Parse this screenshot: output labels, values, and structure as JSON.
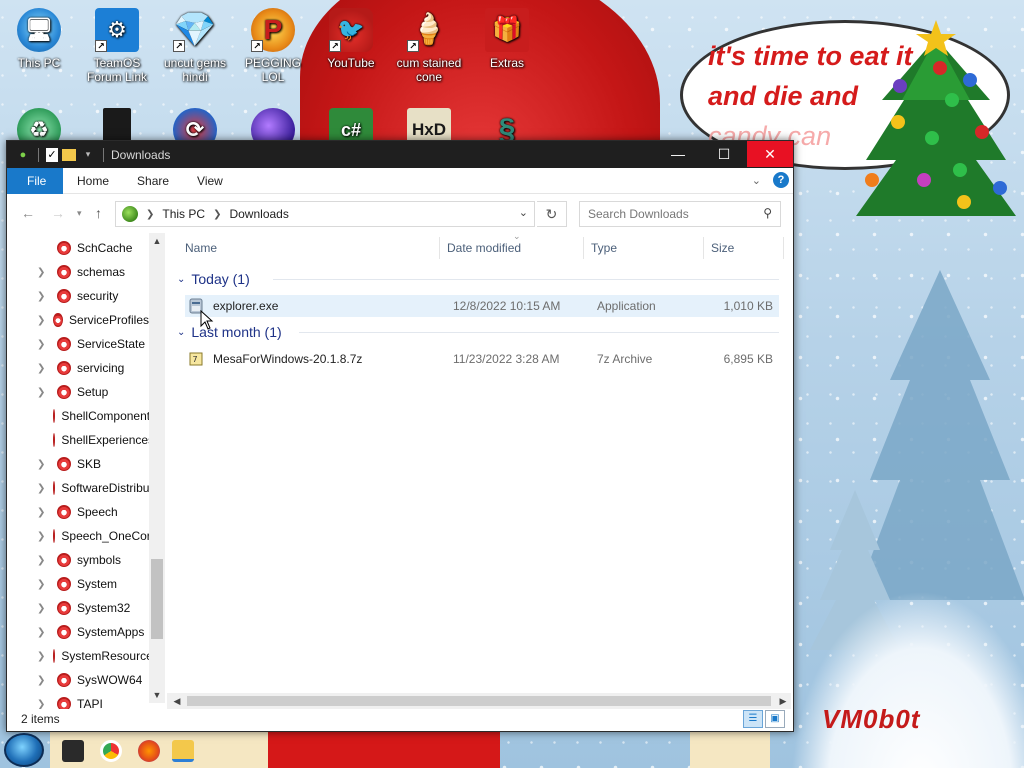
{
  "desktop": {
    "icons_row1": [
      {
        "label": "This PC",
        "icon": "this-pc-icon"
      },
      {
        "label": "TeamOS Forum Link",
        "icon": "gear-icon"
      },
      {
        "label": "uncut gems hindi",
        "icon": "diamond-icon"
      },
      {
        "label": "PEGGING LOL",
        "icon": "peggle-icon"
      },
      {
        "label": "YouTube",
        "icon": "angry-bird-icon"
      },
      {
        "label": "cum stained cone",
        "icon": "traffic-cone-icon"
      },
      {
        "label": "Extras",
        "icon": "gift-box-icon"
      }
    ],
    "icons_row2": [
      {
        "icon": "recycle-bin-icon"
      },
      {
        "icon": "book-icon"
      },
      {
        "icon": "chrome-like-icon"
      },
      {
        "icon": "christmas-ball-icon"
      },
      {
        "label": "c#",
        "icon": "csharp-icon"
      },
      {
        "label": "HxD",
        "icon": "hxd-icon"
      },
      {
        "icon": "snake-icon"
      }
    ],
    "bubble_lines": [
      "it's time to eat it",
      "and die and ",
      "candy can"
    ],
    "signature": "VM0b0t",
    "colors": {
      "hat_red": "#c41616",
      "bubble_text": "#d51b1b",
      "window_accent": "#1979ca"
    }
  },
  "window": {
    "title": "Downloads",
    "controls": {
      "minimize": "—",
      "maximize": "☐",
      "close": "✕"
    },
    "ribbon_tabs": [
      "File",
      "Home",
      "Share",
      "View"
    ],
    "address": {
      "crumbs": [
        "This PC",
        "Downloads"
      ]
    },
    "search": {
      "placeholder": "Search Downloads"
    },
    "nav_pane": [
      {
        "label": "SchCache",
        "expandable": false
      },
      {
        "label": "schemas",
        "expandable": true
      },
      {
        "label": "security",
        "expandable": true
      },
      {
        "label": "ServiceProfiles",
        "expandable": true
      },
      {
        "label": "ServiceState",
        "expandable": true
      },
      {
        "label": "servicing",
        "expandable": true
      },
      {
        "label": "Setup",
        "expandable": true
      },
      {
        "label": "ShellComponents",
        "expandable": false
      },
      {
        "label": "ShellExperiences",
        "expandable": false
      },
      {
        "label": "SKB",
        "expandable": true
      },
      {
        "label": "SoftwareDistribution",
        "expandable": true
      },
      {
        "label": "Speech",
        "expandable": true
      },
      {
        "label": "Speech_OneCore",
        "expandable": true
      },
      {
        "label": "symbols",
        "expandable": true
      },
      {
        "label": "System",
        "expandable": true
      },
      {
        "label": "System32",
        "expandable": true
      },
      {
        "label": "SystemApps",
        "expandable": true
      },
      {
        "label": "SystemResources",
        "expandable": true
      },
      {
        "label": "SysWOW64",
        "expandable": true
      },
      {
        "label": "TAPI",
        "expandable": true
      }
    ],
    "columns": {
      "name": "Name",
      "date": "Date modified",
      "type": "Type",
      "size": "Size"
    },
    "groups": [
      {
        "label": "Today (1)",
        "files": [
          {
            "name": "explorer.exe",
            "date": "12/8/2022 10:15 AM",
            "type": "Application",
            "size": "1,010 KB",
            "icon": "exe-icon",
            "selected": true
          }
        ]
      },
      {
        "label": "Last month (1)",
        "files": [
          {
            "name": "MesaForWindows-20.1.8.7z",
            "date": "11/23/2022 3:28 AM",
            "type": "7z Archive",
            "size": "6,895 KB",
            "icon": "archive-icon",
            "selected": false
          }
        ]
      }
    ],
    "status": {
      "item_count": "2 items"
    }
  }
}
